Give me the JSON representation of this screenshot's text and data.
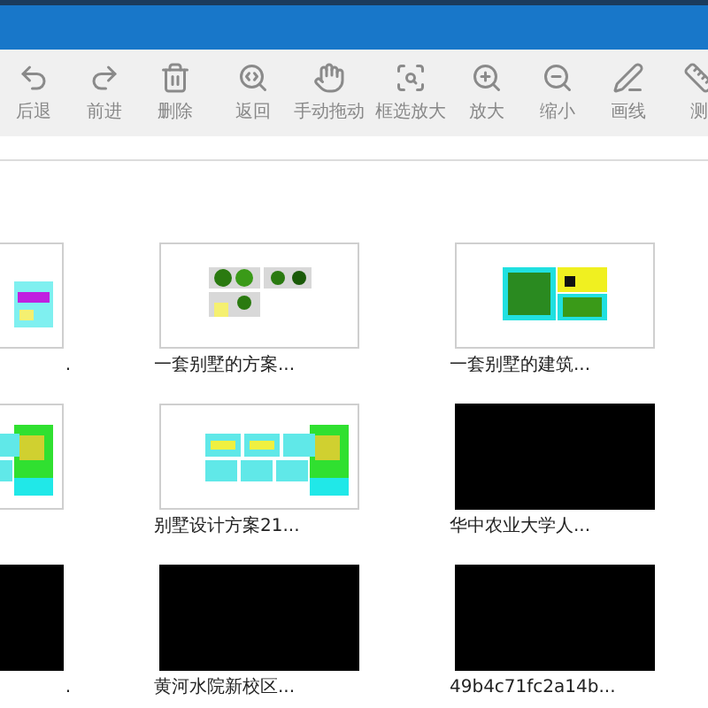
{
  "toolbar": {
    "groups": [
      [
        {
          "label": "后退"
        },
        {
          "label": "前进"
        },
        {
          "label": "删除"
        }
      ],
      [
        {
          "label": "返回"
        },
        {
          "label": "手动拖动"
        },
        {
          "label": "框选放大"
        },
        {
          "label": "放大"
        },
        {
          "label": "缩小"
        },
        {
          "label": "画线"
        },
        {
          "label": "测"
        }
      ]
    ]
  },
  "files": [
    {
      "name": ".",
      "kind": "drawing"
    },
    {
      "name": "一套别墅的方案...",
      "kind": "drawing"
    },
    {
      "name": "一套别墅的建筑...",
      "kind": "drawing"
    },
    {
      "kind": "drawing"
    },
    {
      "name": "别墅设计方案21...",
      "kind": "drawing"
    },
    {
      "name": "华中农业大学人...",
      "kind": "black"
    },
    {
      "name": ".",
      "kind": "black"
    },
    {
      "name": "黄河水院新校区...",
      "kind": "black"
    },
    {
      "name": "49b4c71fc2a14b...",
      "kind": "black"
    }
  ]
}
